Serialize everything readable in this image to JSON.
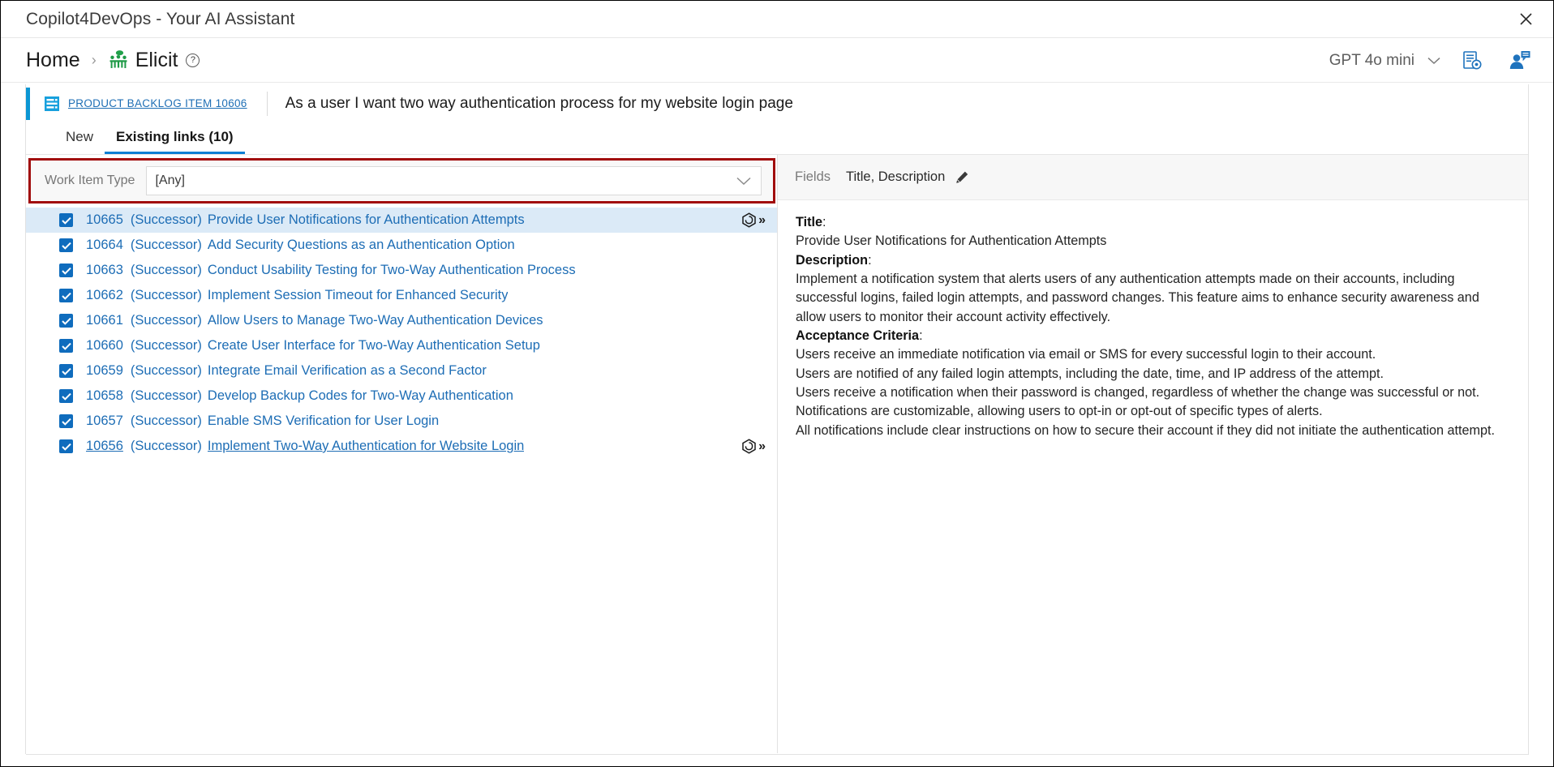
{
  "window": {
    "title": "Copilot4DevOps - Your AI Assistant",
    "close_label": "✕",
    "close_icon": "close-icon"
  },
  "breadcrumb": {
    "home_label": "Home",
    "separator": "›",
    "current_label": "Elicit",
    "current_icon": "elicit-people-meeting-icon",
    "help_icon_label": "?"
  },
  "toolbar": {
    "model_name": "GPT 4o mini",
    "model_chevron_icon": "chevron-down-icon",
    "report_icon": "document-settings-icon",
    "user_chat_icon": "user-feedback-icon"
  },
  "work_item": {
    "type_icon": "product-backlog-item-icon",
    "id_link": "PRODUCT BACKLOG ITEM 10606",
    "title": "As a user I want two way authentication process for my website login page"
  },
  "tabs": [
    {
      "label": "New",
      "active": false
    },
    {
      "label": "Existing links (10)",
      "active": true
    }
  ],
  "filter": {
    "label": "Work Item Type",
    "value": "[Any]",
    "placeholder": "[Any]",
    "chevron_icon": "chevron-down-icon",
    "highlight_color": "#a10b0b"
  },
  "links": [
    {
      "id": "10665",
      "relation": "(Successor)",
      "title": "Provide User Notifications for Authentication Attempts",
      "checked": true,
      "selected": true,
      "hovered": false,
      "has_actions": true
    },
    {
      "id": "10664",
      "relation": "(Successor)",
      "title": "Add Security Questions as an Authentication Option",
      "checked": true,
      "selected": false,
      "hovered": false,
      "has_actions": false
    },
    {
      "id": "10663",
      "relation": "(Successor)",
      "title": "Conduct Usability Testing for Two-Way Authentication Process",
      "checked": true,
      "selected": false,
      "hovered": false,
      "has_actions": false
    },
    {
      "id": "10662",
      "relation": "(Successor)",
      "title": "Implement Session Timeout for Enhanced Security",
      "checked": true,
      "selected": false,
      "hovered": false,
      "has_actions": false
    },
    {
      "id": "10661",
      "relation": "(Successor)",
      "title": "Allow Users to Manage Two-Way Authentication Devices",
      "checked": true,
      "selected": false,
      "hovered": false,
      "has_actions": false
    },
    {
      "id": "10660",
      "relation": "(Successor)",
      "title": "Create User Interface for Two-Way Authentication Setup",
      "checked": true,
      "selected": false,
      "hovered": false,
      "has_actions": false
    },
    {
      "id": "10659",
      "relation": "(Successor)",
      "title": "Integrate Email Verification as a Second Factor",
      "checked": true,
      "selected": false,
      "hovered": false,
      "has_actions": false
    },
    {
      "id": "10658",
      "relation": "(Successor)",
      "title": "Develop Backup Codes for Two-Way Authentication",
      "checked": true,
      "selected": false,
      "hovered": false,
      "has_actions": false
    },
    {
      "id": "10657",
      "relation": "(Successor)",
      "title": "Enable SMS Verification for User Login",
      "checked": true,
      "selected": false,
      "hovered": false,
      "has_actions": false
    },
    {
      "id": "10656",
      "relation": "(Successor)",
      "title": "Implement Two-Way Authentication for Website Login",
      "checked": true,
      "selected": false,
      "hovered": true,
      "has_actions": true
    }
  ],
  "row_action_icons": {
    "expand_icon": "cube-hex-icon",
    "chevron_double_right": "»"
  },
  "details": {
    "fields_label": "Fields",
    "fields_value": "Title, Description",
    "edit_icon": "pencil-icon",
    "title_heading": "Title",
    "title_value": "Provide User Notifications for Authentication Attempts",
    "description_heading": "Description",
    "description_paragraph": "Implement a notification system that alerts users of any authentication attempts made on their accounts, including successful logins, failed login attempts, and password changes. This feature aims to enhance security awareness and allow users to monitor their account activity effectively.",
    "acceptance_heading": "Acceptance Criteria",
    "acceptance_items": [
      "Users receive an immediate notification via email or SMS for every successful login to their account.",
      "Users are notified of any failed login attempts, including the date, time, and IP address of the attempt.",
      "Users receive a notification when their password is changed, regardless of whether the change was successful or not.",
      "Notifications are customizable, allowing users to opt-in or opt-out of specific types of alerts.",
      "All notifications include clear instructions on how to secure their account if they did not initiate the authentication attempt."
    ]
  },
  "colors": {
    "accent_blue": "#0b96d3",
    "link_blue": "#1d6db5",
    "tab_active_blue": "#0a7fd4",
    "checkbox_blue": "#0f6cbd",
    "selection_bg": "#dbeaf7",
    "highlight_red": "#a10b0b",
    "elicit_green": "#21a04a"
  }
}
